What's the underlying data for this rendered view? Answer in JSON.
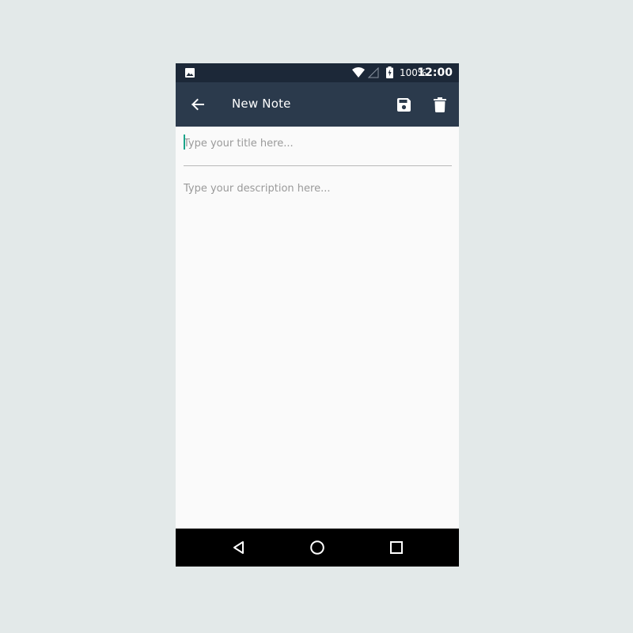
{
  "status_bar": {
    "battery_percent": "100%",
    "time": "12:00",
    "icons": [
      "gallery-icon",
      "wifi-icon",
      "cell-signal-icon",
      "battery-charging-icon"
    ]
  },
  "app_bar": {
    "title": "New Note",
    "icons": [
      "arrow-back-icon",
      "save-icon",
      "delete-icon"
    ],
    "background_color": "#2b3a4c"
  },
  "editor": {
    "title_placeholder": "Type your title here...",
    "title_value": "",
    "description_placeholder": "Type your description here...",
    "description_value": "",
    "cursor_color": "#1aa58a"
  },
  "nav_bar": {
    "icons": [
      "nav-back-icon",
      "nav-home-icon",
      "nav-recent-icon"
    ]
  }
}
